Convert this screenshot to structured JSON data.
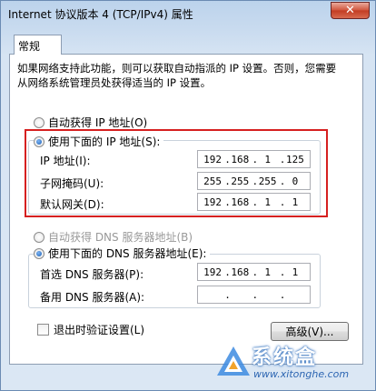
{
  "window": {
    "title": "Internet 协议版本 4 (TCP/IPv4) 属性",
    "close_label": "✕"
  },
  "tabs": [
    {
      "label": "常规"
    }
  ],
  "description": "如果网络支持此功能，则可以获取自动指派的 IP 设置。否则，您需要从网络系统管理员处获得适当的 IP 设置。",
  "ip_section": {
    "auto_label": "自动获得 IP 地址(O)",
    "manual_label": "使用下面的 IP 地址(S):",
    "fields": [
      {
        "label": "IP 地址(I):",
        "value": [
          "192",
          "168",
          "1",
          "125"
        ]
      },
      {
        "label": "子网掩码(U):",
        "value": [
          "255",
          "255",
          "255",
          "0"
        ]
      },
      {
        "label": "默认网关(D):",
        "value": [
          "192",
          "168",
          "1",
          "1"
        ]
      }
    ]
  },
  "dns_section": {
    "auto_label": "自动获得 DNS 服务器地址(B)",
    "manual_label": "使用下面的 DNS 服务器地址(E):",
    "fields": [
      {
        "label": "首选 DNS 服务器(P):",
        "value": [
          "192",
          "168",
          "1",
          "1"
        ]
      },
      {
        "label": "备用 DNS 服务器(A):",
        "value": [
          "",
          "",
          "",
          ""
        ]
      }
    ]
  },
  "validate_label": "退出时验证设置(L)",
  "advanced_label": "高级(V)...",
  "watermark": {
    "title": "系统盒",
    "url": "www.xitonghe.com"
  },
  "colors": {
    "highlight": "#d62020",
    "accent": "#1b5db3"
  }
}
